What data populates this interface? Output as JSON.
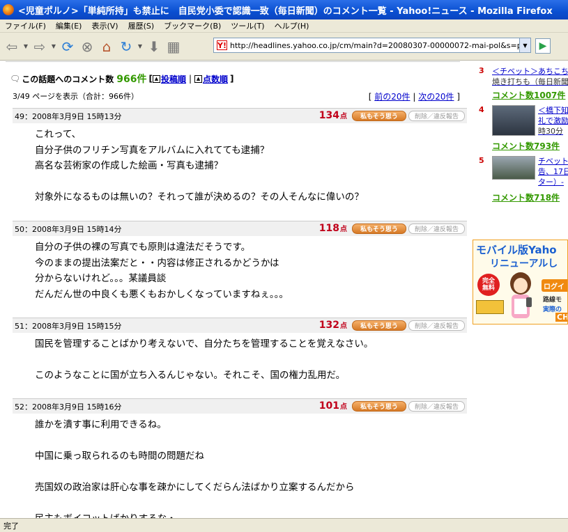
{
  "window": {
    "title": "<児童ポルノ>「単純所持」も禁止に　自民党小委で認識一致（毎日新聞）のコメント一覧 - Yahoo!ニュース - Mozilla Firefox"
  },
  "menu": {
    "items": [
      "ファイル(F)",
      "編集(E)",
      "表示(V)",
      "履歴(S)",
      "ブックマーク(B)",
      "ツール(T)",
      "ヘルプ(H)"
    ]
  },
  "toolbar": {
    "url": "http://headlines.yahoo.co.jp/cm/main?d=20080307-00000072-mai-pol&s=points&o"
  },
  "header": {
    "label": "この話題へのコメント数",
    "count": "966件",
    "bracket_open": "[",
    "sort_posted": "投稿順",
    "separator": "|",
    "sort_points": "点数順",
    "bracket_close": "]"
  },
  "paging": {
    "info": "3/49 ページを表示（合計：966件）",
    "bracket_open": "[",
    "prev": "前の20件",
    "separator": "|",
    "next": "次の20件",
    "bracket_close": "]"
  },
  "comments": [
    {
      "meta": "49：2008年3月9日 15時13分",
      "points": "134",
      "unit": "点",
      "agree": "私もそう思う",
      "report": "削除／違反報告",
      "body": "これって、\n自分子供のフリチン写真をアルバムに入れてても逮捕？\n高名な芸術家の作成した絵画・写真も逮捕？\n\n対象外になるものは無いの？それって誰が決めるの？その人そんなに偉いの？"
    },
    {
      "meta": "50：2008年3月9日 15時14分",
      "points": "118",
      "unit": "点",
      "agree": "私もそう思う",
      "report": "削除／違反報告",
      "body": "自分の子供の裸の写真でも原則は違法だそうです。\n今のままの提出法案だと・・内容は修正されるかどうかは\n分からないけれど。。。某議員談\nだんだん世の中良くも悪くもおかしくなっていますねぇ。。。"
    },
    {
      "meta": "51：2008年3月9日 15時15分",
      "points": "132",
      "unit": "点",
      "agree": "私もそう思う",
      "report": "削除／違反報告",
      "body": "国民を管理することばかり考えないで、自分たちを管理することを覚えなさい。\n\nこのようなことに国が立ち入るんじゃない。それこそ、国の権力乱用だ。"
    },
    {
      "meta": "52：2008年3月9日 15時16分",
      "points": "101",
      "unit": "点",
      "agree": "私もそう思う",
      "report": "削除／違反報告",
      "body": "誰かを潰す事に利用できるね。\n\n中国に乗っ取られるのも時間の問題だね\n\n売国奴の政治家は肝心な事を疎かにしてくだらん法ばかり立案するんだから\n\n民主もボイコットばかりするな・"
    }
  ],
  "sidebar": {
    "ranking": [
      {
        "rank": "3",
        "title": "＜チベット＞あちこち",
        "subtitle": "焼き打ちも（毎日新聞",
        "count": "コメント数1007件"
      },
      {
        "rank": "4",
        "title": "＜橋下知",
        "subtitle": "礼で激励",
        "extra": "時30分",
        "count": "コメント数793件"
      },
      {
        "rank": "5",
        "title": "チベット",
        "subtitle": "告、17日",
        "extra": "ター）-",
        "count": "コメント数718件"
      }
    ],
    "ad": {
      "title": "モバイル版Yaho",
      "title2": "リニューアルし",
      "badge_line1": "完全",
      "badge_line2": "無料",
      "login": "ログイ",
      "text1": "路線モ",
      "text2": "実際の",
      "cta": "CH"
    }
  },
  "status": {
    "text": "完了"
  }
}
